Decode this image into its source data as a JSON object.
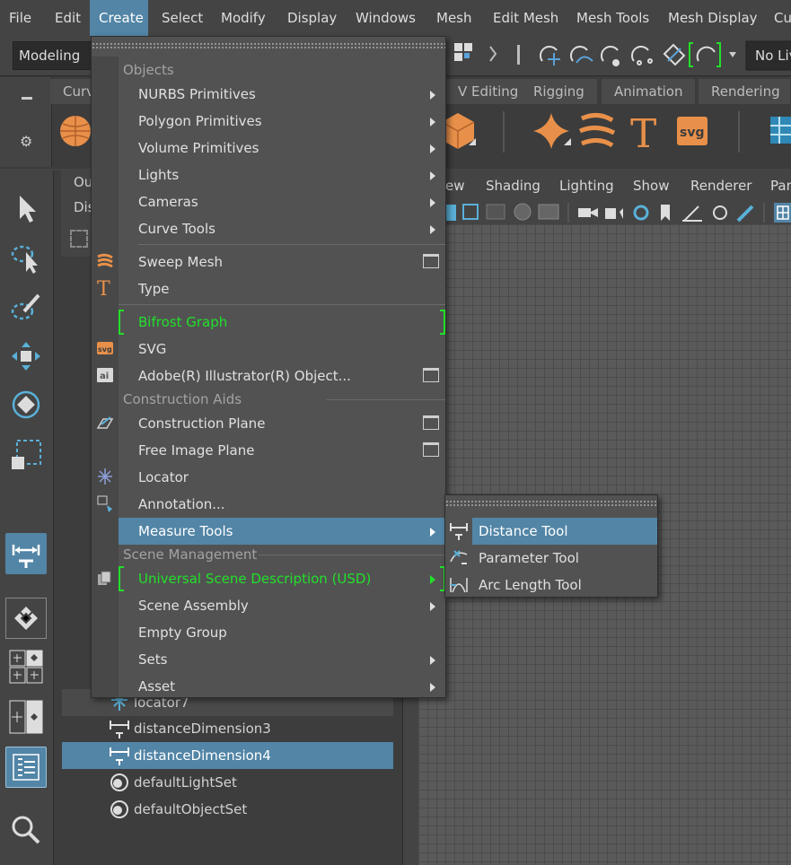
{
  "menubar": {
    "items": [
      "File",
      "Edit",
      "Create",
      "Select",
      "Modify",
      "Display",
      "Windows",
      "Mesh",
      "Edit Mesh",
      "Mesh Tools",
      "Mesh Display",
      "Cu"
    ],
    "active": "Create"
  },
  "status_line": {
    "mode": "Modeling",
    "live_label": "No Liv"
  },
  "shelf": {
    "tabs": [
      "Curv",
      "V Editing",
      "Rigging",
      "Animation",
      "Rendering"
    ],
    "svg_label": "svg"
  },
  "outliner": {
    "tabs": [
      "Ou",
      "Dis"
    ],
    "rows": [
      {
        "label": "locator7",
        "selected": false,
        "icon": "locator-icon"
      },
      {
        "label": "distanceDimension3",
        "selected": false,
        "icon": "distance-dimension-icon"
      },
      {
        "label": "distanceDimension4",
        "selected": true,
        "icon": "distance-dimension-icon"
      },
      {
        "label": "defaultLightSet",
        "selected": false,
        "icon": "set-icon"
      },
      {
        "label": "defaultObjectSet",
        "selected": false,
        "icon": "set-icon"
      }
    ]
  },
  "viewport": {
    "menu": [
      "ew",
      "Shading",
      "Lighting",
      "Show",
      "Renderer",
      "Pan"
    ]
  },
  "create_menu": {
    "sections": {
      "objects": "Objects",
      "construction_aids": "Construction Aids",
      "scene_management": "Scene Management"
    },
    "items": {
      "nurbs": "NURBS Primitives",
      "polygon": "Polygon Primitives",
      "volume": "Volume Primitives",
      "lights": "Lights",
      "cameras": "Cameras",
      "curve_tools": "Curve Tools",
      "sweep_mesh": "Sweep Mesh",
      "type": "Type",
      "bifrost": "Bifrost Graph",
      "svg": "SVG",
      "illustrator": "Adobe(R) Illustrator(R) Object...",
      "construction_plane": "Construction Plane",
      "free_image_plane": "Free Image Plane",
      "locator": "Locator",
      "annotation": "Annotation...",
      "measure_tools": "Measure Tools",
      "usd": "Universal Scene Description (USD)",
      "scene_assembly": "Scene Assembly",
      "empty_group": "Empty Group",
      "sets": "Sets",
      "asset": "Asset"
    },
    "highlighted": "Measure Tools",
    "icon_labels": {
      "svg": "svg",
      "ai": "ai",
      "type": "T"
    }
  },
  "measure_submenu": {
    "items": [
      "Distance Tool",
      "Parameter Tool",
      "Arc Length Tool"
    ],
    "highlighted": "Distance Tool"
  },
  "colors": {
    "highlight": "#5285a6",
    "bifrost_green": "#22e02a",
    "menu_bg": "#525252",
    "icon_orange": "#e8904a"
  }
}
